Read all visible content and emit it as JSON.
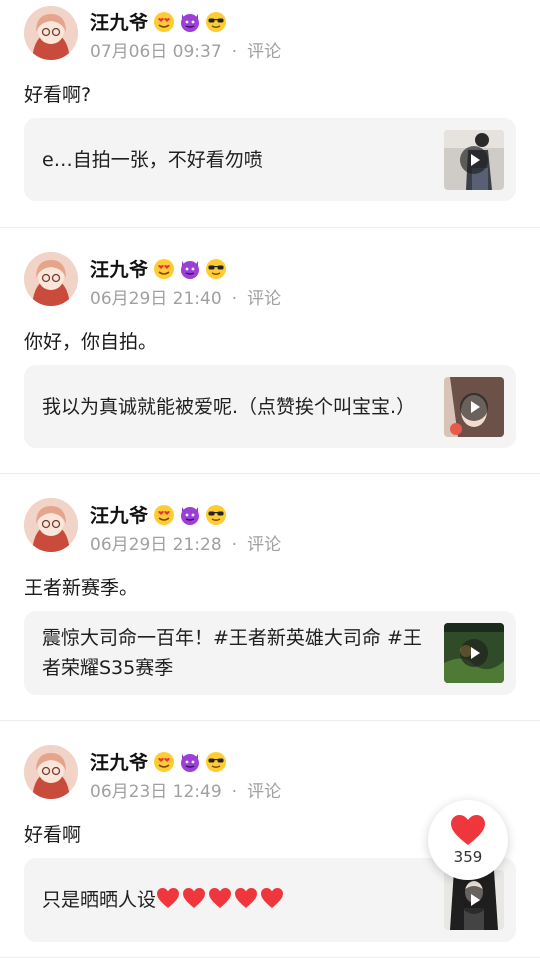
{
  "posts": [
    {
      "author": "汪九爷",
      "date": "07月06日 09:37",
      "sep": "·",
      "comment": "评论",
      "text": "好看啊?",
      "card_text": "e…自拍一张，不好看勿喷",
      "emojis": [
        "heart-eyes-emoji",
        "devil-emoji",
        "sunglasses-emoji"
      ]
    },
    {
      "author": "汪九爷",
      "date": "06月29日 21:40",
      "sep": "·",
      "comment": "评论",
      "text": "你好，你自拍。",
      "card_text": "我以为真诚就能被爱呢.（点赞挨个叫宝宝.）",
      "emojis": [
        "heart-eyes-emoji",
        "devil-emoji",
        "sunglasses-emoji"
      ]
    },
    {
      "author": "汪九爷",
      "date": "06月29日 21:28",
      "sep": "·",
      "comment": "评论",
      "text": "王者新赛季。",
      "card_text": "震惊大司命一百年！#王者新英雄大司命 #王者荣耀S35赛季",
      "emojis": [
        "heart-eyes-emoji",
        "devil-emoji",
        "sunglasses-emoji"
      ]
    },
    {
      "author": "汪九爷",
      "date": "06月23日 12:49",
      "sep": "·",
      "comment": "评论",
      "text": "好看啊",
      "card_text": "只是晒晒人设",
      "card_hearts": 5,
      "emojis": [
        "heart-eyes-emoji",
        "devil-emoji",
        "sunglasses-emoji"
      ]
    }
  ],
  "like_button": {
    "count": "359",
    "icon": "heart-icon"
  },
  "colors": {
    "heart": "#f0363d",
    "meta_text": "#a0a0a0",
    "card_bg": "#f4f4f4"
  }
}
